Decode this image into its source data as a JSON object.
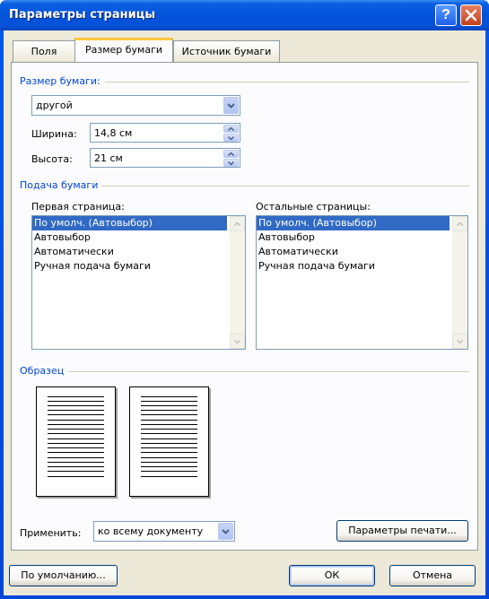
{
  "window": {
    "title": "Параметры страницы"
  },
  "tabs": [
    {
      "label": "Поля"
    },
    {
      "label": "Размер бумаги"
    },
    {
      "label": "Источник бумаги"
    }
  ],
  "paper_size": {
    "group_title": "Размер бумаги:",
    "selected": "другой",
    "width_label": "Ширина:",
    "width_value": "14,8 см",
    "height_label": "Высота:",
    "height_value": "21 см"
  },
  "paper_feed": {
    "group_title": "Подача бумаги",
    "first_page_label": "Первая страница:",
    "other_pages_label": "Остальные страницы:",
    "first_page_items": [
      "По умолч. (Автовыбор)",
      "Автовыбор",
      "Автоматически",
      "Ручная подача бумаги"
    ],
    "other_pages_items": [
      "По умолч. (Автовыбор)",
      "Автовыбор",
      "Автоматически",
      "Ручная подача бумаги"
    ],
    "first_page_selected": 0,
    "other_pages_selected": 0
  },
  "preview": {
    "group_title": "Образец"
  },
  "apply": {
    "label": "Применить:",
    "value": "ко всему документу"
  },
  "buttons": {
    "print_options": "Параметры печати...",
    "default": "По умолчанию...",
    "ok": "ОК",
    "cancel": "Отмена"
  },
  "colors": {
    "accent": "#0046d5",
    "selection": "#316ac5",
    "titlebar": "#0453dc"
  },
  "icons": {
    "help": "help-icon",
    "close": "close-icon",
    "dropdown": "chevron-down-icon"
  }
}
